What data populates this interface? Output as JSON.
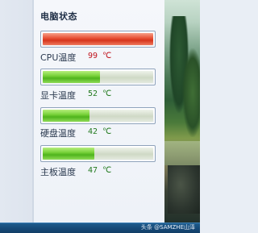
{
  "panel": {
    "title": "电脑状态",
    "sensors": [
      {
        "label": "CPU温度",
        "value": "99 ℃",
        "level": 1.0,
        "status": "hot"
      },
      {
        "label": "显卡温度",
        "value": "52 ℃",
        "level": 0.52,
        "status": "ok"
      },
      {
        "label": "硬盘温度",
        "value": "42 ℃",
        "level": 0.42,
        "status": "ok"
      },
      {
        "label": "主板温度",
        "value": "47 ℃",
        "level": 0.47,
        "status": "ok"
      }
    ]
  },
  "taskbar": {
    "watermark": "头条 @SAMZHE山泽"
  },
  "colors": {
    "hot_fill": "#e24a2f",
    "ok_fill": "#6cc92c",
    "hot_text": "#c0141c",
    "ok_text": "#237a1f"
  }
}
